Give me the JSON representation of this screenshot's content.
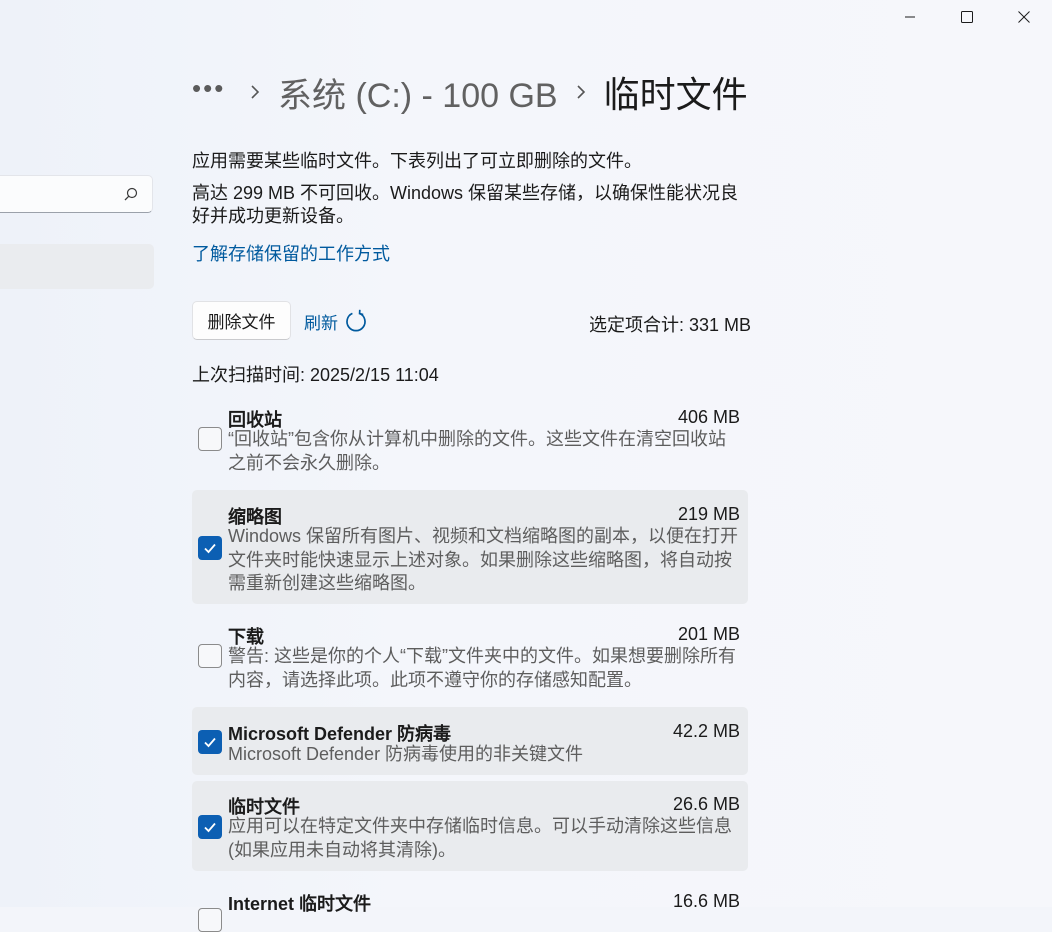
{
  "window_controls": [
    "minimize-icon",
    "maximize-icon",
    "close-icon"
  ],
  "breadcrumb": {
    "overflow": "•••",
    "parent": "系统 (C:) - 100 GB",
    "current": "临时文件"
  },
  "description": {
    "line1": "应用需要某些临时文件。下表列出了可立即删除的文件。",
    "line2": "高达 299 MB 不可回收。Windows 保留某些存储，以确保性能状况良好并成功更新设备。",
    "link": "了解存储保留的工作方式"
  },
  "actions": {
    "delete_label": "删除文件",
    "refresh_label": "刷新",
    "total": "选定项合计: 331 MB"
  },
  "scan_time": "上次扫描时间: 2025/2/15 11:04",
  "items": [
    {
      "title": "回收站",
      "size": "406 MB",
      "checked": false,
      "desc": "“回收站”包含你从计算机中删除的文件。这些文件在清空回收站之前不会永久删除。"
    },
    {
      "title": "缩略图",
      "size": "219 MB",
      "checked": true,
      "desc": "Windows 保留所有图片、视频和文档缩略图的副本，以便在打开文件夹时能快速显示上述对象。如果删除这些缩略图，将自动按需重新创建这些缩略图。"
    },
    {
      "title": "下载",
      "size": "201 MB",
      "checked": false,
      "desc": "警告: 这些是你的个人“下载”文件夹中的文件。如果想要删除所有内容，请选择此项。此项不遵守你的存储感知配置。"
    },
    {
      "title": "Microsoft Defender 防病毒",
      "size": "42.2 MB",
      "checked": true,
      "desc": "Microsoft Defender 防病毒使用的非关键文件"
    },
    {
      "title": "临时文件",
      "size": "26.6 MB",
      "checked": true,
      "desc": "应用可以在特定文件夹中存储临时信息。可以手动清除这些信息(如果应用未自动将其清除)。"
    },
    {
      "title": "Internet 临时文件",
      "size": "16.6 MB",
      "checked": false,
      "desc": ""
    }
  ]
}
